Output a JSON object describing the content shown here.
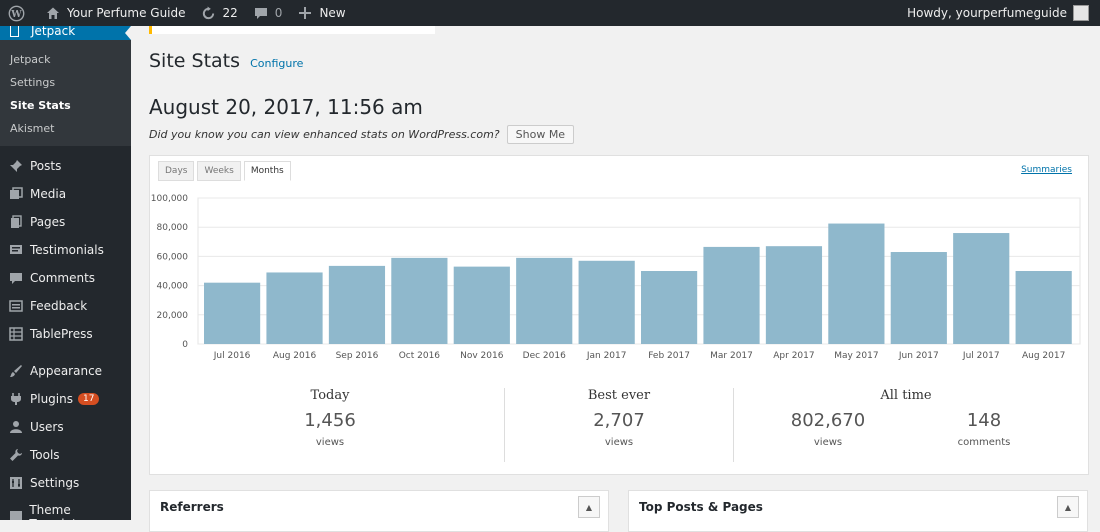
{
  "admin_bar": {
    "site_name": "Your Perfume Guide",
    "updates_count": "22",
    "comments_count": "0",
    "new_label": "New",
    "howdy": "Howdy, yourperfumeguide"
  },
  "sidebar": {
    "current": "Jetpack",
    "submenu": [
      "Jetpack",
      "Settings",
      "Site Stats",
      "Akismet"
    ],
    "items": [
      {
        "label": "Posts",
        "icon": "pin-icon"
      },
      {
        "label": "Media",
        "icon": "media-icon"
      },
      {
        "label": "Pages",
        "icon": "pages-icon"
      },
      {
        "label": "Testimonials",
        "icon": "testimonials-icon"
      },
      {
        "label": "Comments",
        "icon": "comment-icon"
      },
      {
        "label": "Feedback",
        "icon": "feedback-icon"
      },
      {
        "label": "TablePress",
        "icon": "table-icon"
      },
      {
        "label": "Appearance",
        "icon": "brush-icon"
      },
      {
        "label": "Plugins",
        "icon": "plug-icon",
        "badge": "17"
      },
      {
        "label": "Users",
        "icon": "user-icon"
      },
      {
        "label": "Tools",
        "icon": "wrench-icon"
      },
      {
        "label": "Settings",
        "icon": "settings-icon"
      },
      {
        "label": "Theme Templates",
        "icon": "template-icon"
      }
    ]
  },
  "page": {
    "title": "Site Stats",
    "configure_link": "Configure",
    "date": "August 20, 2017, 11:56 am",
    "tip": "Did you know you can view enhanced stats on WordPress.com?",
    "show_me": "Show Me"
  },
  "tabs": [
    "Days",
    "Weeks",
    "Months"
  ],
  "active_tab": "Months",
  "summaries_link": "Summaries",
  "chart_data": {
    "type": "bar",
    "categories": [
      "Jul 2016",
      "Aug 2016",
      "Sep 2016",
      "Oct 2016",
      "Nov 2016",
      "Dec 2016",
      "Jan 2017",
      "Feb 2017",
      "Mar 2017",
      "Apr 2017",
      "May 2017",
      "Jun 2017",
      "Jul 2017",
      "Aug 2017"
    ],
    "values": [
      42000,
      49000,
      53500,
      59000,
      53000,
      59000,
      57000,
      50000,
      66500,
      67000,
      82500,
      63000,
      76000,
      50000
    ],
    "yticks": [
      "0",
      "20,000",
      "40,000",
      "60,000",
      "80,000",
      "100,000"
    ],
    "ylim": [
      0,
      100000
    ],
    "bar_color": "#8fb8cc",
    "grid": true
  },
  "summary": {
    "today": {
      "label": "Today",
      "value": "1,456",
      "unit": "views"
    },
    "best_ever": {
      "label": "Best ever",
      "value": "2,707",
      "unit": "views"
    },
    "all_time": {
      "label": "All time",
      "views": "802,670",
      "views_unit": "views",
      "comments": "148",
      "comments_unit": "comments"
    }
  },
  "boxes": {
    "referrers": "Referrers",
    "top_posts": "Top Posts & Pages"
  }
}
